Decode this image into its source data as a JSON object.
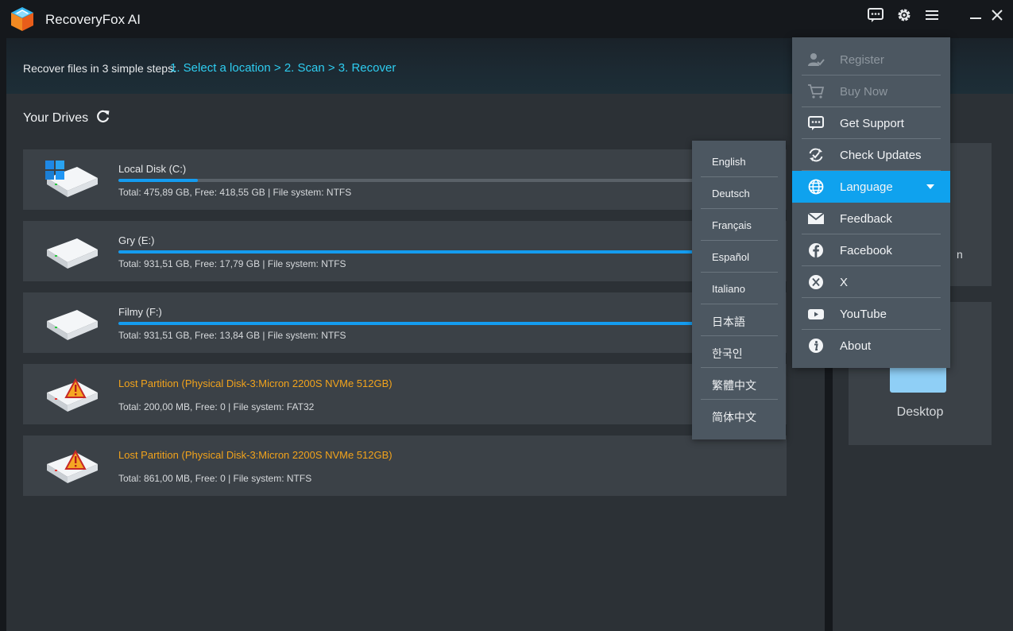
{
  "app": {
    "title": "RecoveryFox AI"
  },
  "steps": {
    "intro": "Recover files in 3 simple steps:",
    "link": "1. Select a location > 2. Scan > 3. Recover"
  },
  "drives_section": {
    "title": "Your Drives"
  },
  "drives": [
    {
      "name": "Local Disk (C:)",
      "info": "Total: 475,89 GB, Free: 418,55 GB | File system: NTFS",
      "used_fraction": 0.12,
      "lost": false,
      "icon": "windows-disk-icon"
    },
    {
      "name": "Gry (E:)",
      "info": "Total: 931,51 GB, Free: 17,79 GB | File system: NTFS",
      "used_fraction": 0.98,
      "lost": false,
      "icon": "disk-icon"
    },
    {
      "name": "Filmy (F:)",
      "info": "Total: 931,51 GB, Free: 13,84 GB | File system: NTFS",
      "used_fraction": 0.985,
      "lost": false,
      "icon": "disk-icon"
    },
    {
      "name": "Lost Partition (Physical Disk-3:Micron 2200S NVMe 512GB)",
      "info": "Total: 200,00 MB, Free: 0 | File system: FAT32",
      "used_fraction": null,
      "lost": true,
      "icon": "warning-disk-icon"
    },
    {
      "name": "Lost Partition (Physical Disk-3:Micron 2200S NVMe 512GB)",
      "info": "Total: 861,00 MB, Free: 0 | File system: NTFS",
      "used_fraction": null,
      "lost": true,
      "icon": "warning-disk-icon"
    }
  ],
  "side_cards": {
    "partial_text": "n",
    "desktop_label": "Desktop"
  },
  "menu": {
    "items": [
      {
        "label": "Register",
        "icon": "user-check-icon",
        "disabled": true
      },
      {
        "label": "Buy Now",
        "icon": "cart-icon",
        "disabled": true
      },
      {
        "label": "Get Support",
        "icon": "chat-icon",
        "disabled": false
      },
      {
        "label": "Check Updates",
        "icon": "refresh-check-icon",
        "disabled": false
      },
      {
        "label": "Language",
        "icon": "globe-icon",
        "disabled": false,
        "active": true
      },
      {
        "label": "Feedback",
        "icon": "mail-icon",
        "disabled": false
      },
      {
        "label": "Facebook",
        "icon": "facebook-icon",
        "disabled": false
      },
      {
        "label": "X",
        "icon": "x-icon",
        "disabled": false
      },
      {
        "label": "YouTube",
        "icon": "youtube-icon",
        "disabled": false
      },
      {
        "label": "About",
        "icon": "info-icon",
        "disabled": false
      }
    ]
  },
  "languages": [
    "English",
    "Deutsch",
    "Français",
    "Español",
    "Italiano",
    "日本語",
    "한국인",
    "繁體中文",
    "简体中文"
  ],
  "colors": {
    "accent": "#0fa2ee",
    "link": "#2ecdf0",
    "lost": "#f2a31b",
    "progress": "#149cf0"
  }
}
